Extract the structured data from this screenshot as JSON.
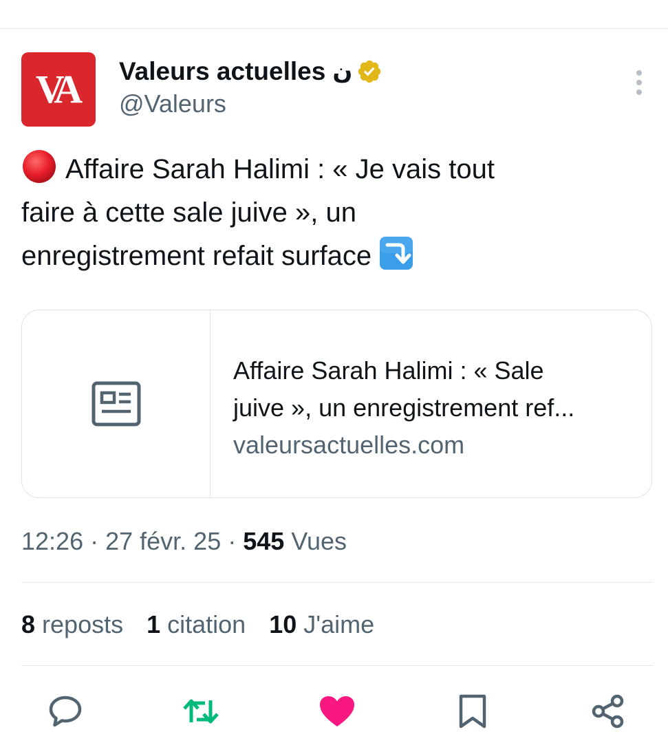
{
  "author": {
    "avatar_text": "VA",
    "display_name": "Valeurs actuelles",
    "name_extra": "ن",
    "handle": "@Valeurs",
    "verified_color": "#e2b719",
    "avatar_color": "#d9272d"
  },
  "tweet": {
    "text_main": "Affaire Sarah Halimi : « Je vais tout faire à cette sale juive », un enregistrement refait surface",
    "leading_emoji": "red-circle-icon",
    "trailing_emoji": "arrow-down-right-curve-icon"
  },
  "link_card": {
    "title_line1": "Affaire Sarah Halimi : « Sale",
    "title_line2": "juive », un enregistrement ref...",
    "domain": "valeursactuelles.com",
    "thumbnail_icon": "article-icon"
  },
  "meta": {
    "time": "12:26",
    "sep1": " · ",
    "date": "27 févr. 25",
    "sep2": " · ",
    "views_count": "545",
    "views_label": " Vues"
  },
  "stats": {
    "reposts_count": "8",
    "reposts_label": " reposts",
    "quotes_count": "1",
    "quotes_label": " citation",
    "likes_count": "10",
    "likes_label": " J'aime"
  },
  "actions": {
    "reply_icon": "reply-icon",
    "repost_icon": "repost-icon",
    "like_icon": "heart-icon",
    "bookmark_icon": "bookmark-icon",
    "share_icon": "share-icon",
    "repost_color": "#00ba7c",
    "like_color": "#f91880",
    "icon_color": "#536471"
  }
}
